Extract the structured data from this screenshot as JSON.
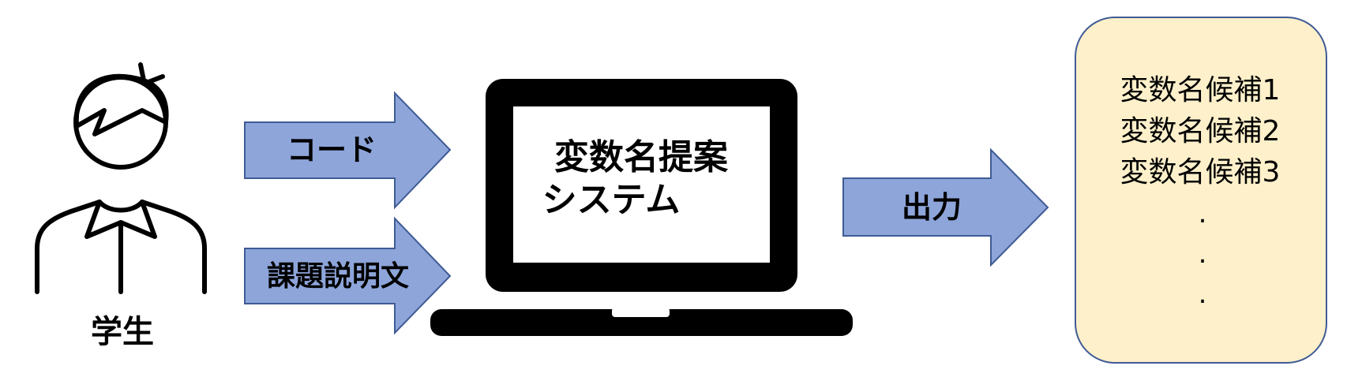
{
  "student": {
    "label": "学生"
  },
  "inputs": {
    "code_label": "コード",
    "description_label": "課題説明文"
  },
  "system": {
    "title_line1": "変数名提案",
    "title_line2": "システム"
  },
  "output": {
    "arrow_label": "出力",
    "candidates": [
      "変数名候補1",
      "変数名候補2",
      "変数名候補3"
    ],
    "ellipsis": [
      ".",
      ".",
      "."
    ]
  },
  "colors": {
    "arrow_fill": "#8EA5DA",
    "arrow_stroke": "#3F5B95",
    "output_box_fill": "#FDF0CA",
    "output_box_stroke": "#3F5B95",
    "laptop": "#000000"
  },
  "icons": {
    "student": "person-icon",
    "system": "laptop-icon"
  }
}
